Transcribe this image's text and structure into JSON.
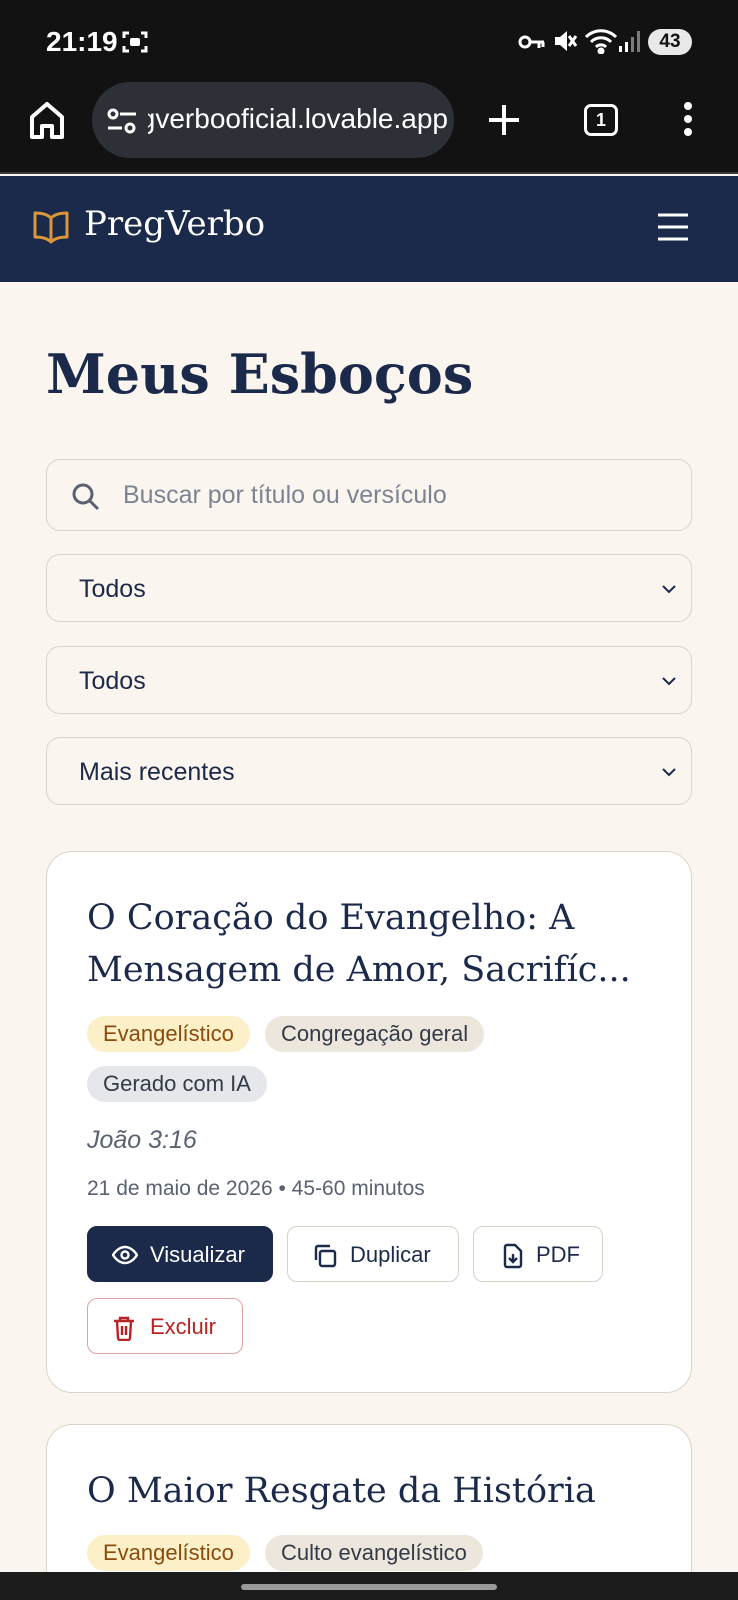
{
  "status_bar": {
    "time": "21:19",
    "battery": "43"
  },
  "browser": {
    "url": "pregverbooficial.lovable.app",
    "tab_count": "1"
  },
  "app": {
    "brand": "PregVerbo"
  },
  "page": {
    "title": "Meus Esboços"
  },
  "filters": {
    "search_placeholder": "Buscar por título ou versículo",
    "type_select": "Todos",
    "audience_select": "Todos",
    "sort_select": "Mais recentes"
  },
  "sermons": [
    {
      "title": "O Coração do Evangelho: A Mensagem de Amor, Sacrifíc...",
      "tags": [
        "Evangelístico",
        "Congregação geral",
        "Gerado com IA"
      ],
      "verse": "João 3:16",
      "meta": "21 de maio de 2026 • 45-60 minutos",
      "actions": {
        "view": "Visualizar",
        "duplicate": "Duplicar",
        "pdf": "PDF",
        "delete": "Excluir"
      }
    },
    {
      "title": "O Maior Resgate da História",
      "tags": [
        "Evangelístico",
        "Culto evangelístico"
      ]
    }
  ],
  "colors": {
    "navy": "#1b2a4a",
    "page_bg": "#faf5ee",
    "accent": "#d9973a",
    "danger": "#b82222"
  }
}
